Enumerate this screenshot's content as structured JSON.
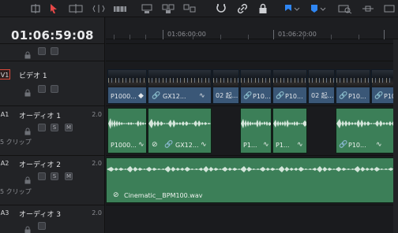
{
  "toolbar": {
    "icons": [
      "trim-icon",
      "select-arrow-icon",
      "blade-icon",
      "insert-icon",
      "overwrite-icon",
      "replace-icon",
      "fit-icon",
      "ripple-icon",
      "snap-icon",
      "link-icon",
      "lock-icon",
      "flag-icon",
      "marker-icon",
      "zoom-icon",
      "zoom-out-icon"
    ]
  },
  "timecode": "01:06:59:08",
  "ruler": {
    "labels": [
      "01:06:00:00",
      "01:06:20:00"
    ]
  },
  "tracks": {
    "v1": {
      "id": "V1",
      "name": "ビデオ 1"
    },
    "a1": {
      "id": "A1",
      "name": "オーディオ 1",
      "volume": "2.0",
      "clips": "5 クリップ",
      "s": "S",
      "m": "M"
    },
    "a2": {
      "id": "A2",
      "name": "オーディオ 2",
      "volume": "2.0",
      "clips": "5 クリップ",
      "s": "S",
      "m": "M"
    },
    "a3": {
      "id": "A3",
      "name": "オーディオ 3",
      "volume": "2.0"
    }
  },
  "video_clips": [
    "P1000...",
    "GX12...",
    "02 起...",
    "P10...",
    "P10...",
    "02 起...",
    "P10...",
    "P10..."
  ],
  "audio1_clips": [
    "P1000...",
    "GX12...",
    "P1...",
    "P1...",
    "P10..."
  ],
  "audio2_clip": "Cinematic__BPM100.wav",
  "colors": {
    "video_clip": "#3a5777",
    "audio_clip": "#3c7f58",
    "record_red": "#d9493a",
    "marker_blue": "#2f86f2"
  }
}
